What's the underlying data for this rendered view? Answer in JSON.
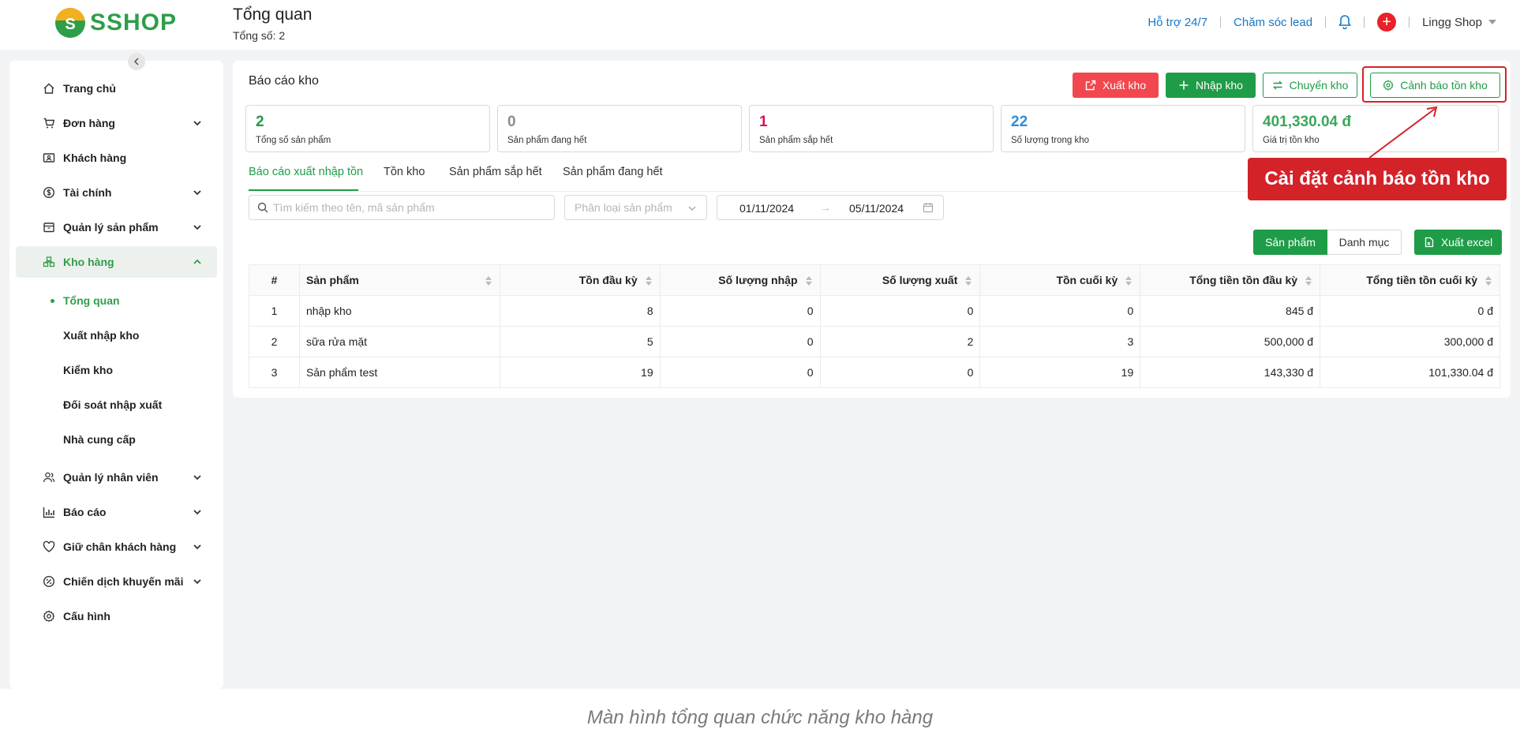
{
  "header": {
    "logo_text": "SSHOP",
    "logo_letter": "S",
    "title": "Tổng quan",
    "count": "Tổng số: 2",
    "links": [
      "Hỗ trợ 24/7",
      "Chăm sóc lead"
    ],
    "plus": "+",
    "user": "Lingg Shop"
  },
  "sidebar": {
    "items": [
      {
        "label": "Trang chủ",
        "icon": "home-icon"
      },
      {
        "label": "Đơn hàng",
        "icon": "cart-icon"
      },
      {
        "label": "Khách hàng",
        "icon": "id-card-icon"
      },
      {
        "label": "Tài chính",
        "icon": "dollar-icon"
      },
      {
        "label": "Quản lý sản phẩm",
        "icon": "box-icon"
      },
      {
        "label": "Kho hàng",
        "icon": "warehouse-icon"
      },
      {
        "label": "Quản lý nhân viên",
        "icon": "users-icon"
      },
      {
        "label": "Báo cáo",
        "icon": "bar-chart-icon"
      },
      {
        "label": "Giữ chân khách hàng",
        "icon": "heart-icon"
      },
      {
        "label": "Chiến dịch khuyến mãi",
        "icon": "percent-icon"
      },
      {
        "label": "Cấu hình",
        "icon": "gear-icon"
      }
    ],
    "sub_items": [
      "Tổng quan",
      "Xuất nhập kho",
      "Kiểm kho",
      "Đối soát nhập xuất",
      "Nhà cung cấp"
    ]
  },
  "card": {
    "title": "Báo cáo kho",
    "buttons": {
      "export": "Xuất kho",
      "import": "Nhập kho",
      "transfer": "Chuyển kho",
      "alert": "Cảnh báo tồn kho"
    }
  },
  "stats": [
    {
      "value": "2",
      "label": "Tổng số sản phẩm",
      "color": "#1f9c48"
    },
    {
      "value": "0",
      "label": "Sản phẩm đang hết",
      "color": "#8c8c8c"
    },
    {
      "value": "1",
      "label": "Sản phẩm sắp hết",
      "color": "#d4145a"
    },
    {
      "value": "22",
      "label": "Số lượng trong kho",
      "color": "#2d8fd6"
    },
    {
      "value": "401,330.04 đ",
      "label": "Giá trị tồn kho",
      "color": "#3aa65a"
    }
  ],
  "tabs": [
    "Báo cáo xuất nhập tồn",
    "Tồn kho",
    "Sản phẩm sắp hết",
    "Sản phẩm đang hết"
  ],
  "filters": {
    "search_placeholder": "Tìm kiếm theo tên, mã sản phẩm",
    "category_placeholder": "Phân loại sản phẩm",
    "date_from": "01/11/2024",
    "date_to": "05/11/2024",
    "date_arrow": "→"
  },
  "view_toggle": {
    "product": "Sản phẩm",
    "category": "Danh mục"
  },
  "export_excel": "Xuất excel",
  "table": {
    "headers": [
      "#",
      "Sản phẩm",
      "Tồn đầu kỳ",
      "Số lượng nhập",
      "Số lượng xuất",
      "Tồn cuối kỳ",
      "Tổng tiền tồn đầu kỳ",
      "Tổng tiền tồn cuối kỳ"
    ],
    "rows": [
      [
        "1",
        "nhập kho",
        "8",
        "0",
        "0",
        "0",
        "845 đ",
        "0 đ"
      ],
      [
        "2",
        "sữa rửa mặt",
        "5",
        "0",
        "2",
        "3",
        "500,000 đ",
        "300,000 đ"
      ],
      [
        "3",
        "Sản phẩm test",
        "19",
        "0",
        "0",
        "19",
        "143,330 đ",
        "101,330.04 đ"
      ]
    ]
  },
  "annotation": "Cài đặt cảnh báo tồn kho",
  "caption": "Màn hình tổng quan chức năng kho hàng"
}
